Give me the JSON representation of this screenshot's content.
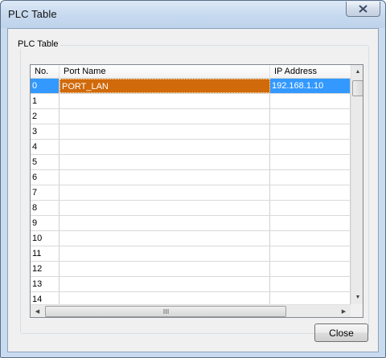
{
  "window": {
    "title": "PLC Table"
  },
  "group": {
    "label": "PLC Table"
  },
  "table": {
    "columns": [
      "No.",
      "Port Name",
      "IP Address"
    ],
    "rows": [
      {
        "no": "0",
        "port": "PORT_LAN",
        "ip": "192.168.1.10"
      },
      {
        "no": "1",
        "port": "",
        "ip": ""
      },
      {
        "no": "2",
        "port": "",
        "ip": ""
      },
      {
        "no": "3",
        "port": "",
        "ip": ""
      },
      {
        "no": "4",
        "port": "",
        "ip": ""
      },
      {
        "no": "5",
        "port": "",
        "ip": ""
      },
      {
        "no": "6",
        "port": "",
        "ip": ""
      },
      {
        "no": "7",
        "port": "",
        "ip": ""
      },
      {
        "no": "8",
        "port": "",
        "ip": ""
      },
      {
        "no": "9",
        "port": "",
        "ip": ""
      },
      {
        "no": "10",
        "port": "",
        "ip": ""
      },
      {
        "no": "11",
        "port": "",
        "ip": ""
      },
      {
        "no": "12",
        "port": "",
        "ip": ""
      },
      {
        "no": "13",
        "port": "",
        "ip": ""
      },
      {
        "no": "14",
        "port": "",
        "ip": ""
      }
    ],
    "selected_index": 0
  },
  "buttons": {
    "close_label": "Close"
  },
  "icons": {
    "title_close": "close-icon",
    "scroll_up": "arrow-up-icon",
    "scroll_down": "arrow-down-icon",
    "scroll_left": "arrow-left-icon",
    "scroll_right": "arrow-right-icon",
    "thumb_grip": "grip-icon"
  },
  "colors": {
    "selection_blue": "#3399ff",
    "selection_orange": "#d06a0a",
    "window_frame": "#c9dbef",
    "dialog_bg": "#f0f0f0"
  }
}
